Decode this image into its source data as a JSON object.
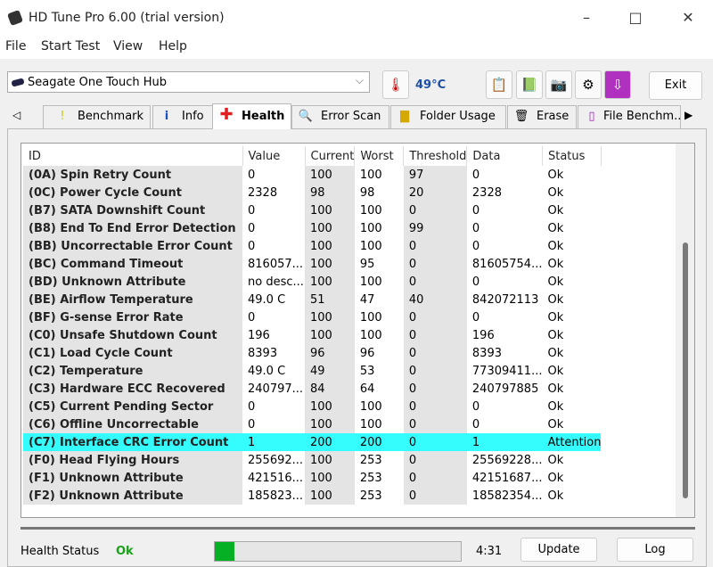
{
  "window": {
    "title": "HD Tune Pro 6.00 (trial version)"
  },
  "menu": [
    "File",
    "Start Test",
    "View",
    "Help"
  ],
  "toolbar": {
    "drive": "Seagate One Touch Hub",
    "temperature": "49°C",
    "exit_label": "Exit"
  },
  "tabs": [
    {
      "label": "Benchmark",
      "icon": "exclamation-icon"
    },
    {
      "label": "Info",
      "icon": "info-icon"
    },
    {
      "label": "Health",
      "icon": "red-cross-icon",
      "active": true
    },
    {
      "label": "Error Scan",
      "icon": "magnifier-icon"
    },
    {
      "label": "Folder Usage",
      "icon": "folder-icon"
    },
    {
      "label": "Erase",
      "icon": "trash-icon"
    },
    {
      "label": "File Benchm...",
      "icon": "file-icon"
    }
  ],
  "table": {
    "columns": [
      "ID",
      "Value",
      "Current",
      "Worst",
      "Threshold",
      "Data",
      "Status"
    ],
    "rows": [
      [
        "(0A) Spin Retry Count",
        "0",
        "100",
        "100",
        "97",
        "0",
        "Ok"
      ],
      [
        "(0C) Power Cycle Count",
        "2328",
        "98",
        "98",
        "20",
        "2328",
        "Ok"
      ],
      [
        "(B7) SATA Downshift Count",
        "0",
        "100",
        "100",
        "0",
        "0",
        "Ok"
      ],
      [
        "(B8) End To End Error Detection",
        "0",
        "100",
        "100",
        "99",
        "0",
        "Ok"
      ],
      [
        "(BB) Uncorrectable Error Count",
        "0",
        "100",
        "100",
        "0",
        "0",
        "Ok"
      ],
      [
        "(BC) Command Timeout",
        "816057...",
        "100",
        "95",
        "0",
        "81605754...",
        "Ok"
      ],
      [
        "(BD) Unknown Attribute",
        "no desc...",
        "100",
        "100",
        "0",
        "0",
        "Ok"
      ],
      [
        "(BE) Airflow Temperature",
        "49.0 C",
        "51",
        "47",
        "40",
        "842072113",
        "Ok"
      ],
      [
        "(BF) G-sense Error Rate",
        "0",
        "100",
        "100",
        "0",
        "0",
        "Ok"
      ],
      [
        "(C0) Unsafe Shutdown Count",
        "196",
        "100",
        "100",
        "0",
        "196",
        "Ok"
      ],
      [
        "(C1) Load Cycle Count",
        "8393",
        "96",
        "96",
        "0",
        "8393",
        "Ok"
      ],
      [
        "(C2) Temperature",
        "49.0 C",
        "49",
        "53",
        "0",
        "77309411...",
        "Ok"
      ],
      [
        "(C3) Hardware ECC Recovered",
        "240797...",
        "84",
        "64",
        "0",
        "240797885",
        "Ok"
      ],
      [
        "(C5) Current Pending Sector",
        "0",
        "100",
        "100",
        "0",
        "0",
        "Ok"
      ],
      [
        "(C6) Offline Uncorrectable",
        "0",
        "100",
        "100",
        "0",
        "0",
        "Ok"
      ],
      [
        "(C7) Interface CRC Error Count",
        "1",
        "200",
        "200",
        "0",
        "1",
        "Attention"
      ],
      [
        "(F0) Head Flying Hours",
        "255692...",
        "100",
        "253",
        "0",
        "25569228...",
        "Ok"
      ],
      [
        "(F1) Unknown Attribute",
        "421516...",
        "100",
        "253",
        "0",
        "42151687...",
        "Ok"
      ],
      [
        "(F2) Unknown Attribute",
        "185823...",
        "100",
        "253",
        "0",
        "18582354...",
        "Ok"
      ]
    ],
    "highlight_color": "#35fdfd"
  },
  "footer": {
    "health_label": "Health Status",
    "health_value": "Ok",
    "progress_percent": 8,
    "time": "4:31",
    "update_label": "Update",
    "log_label": "Log"
  }
}
